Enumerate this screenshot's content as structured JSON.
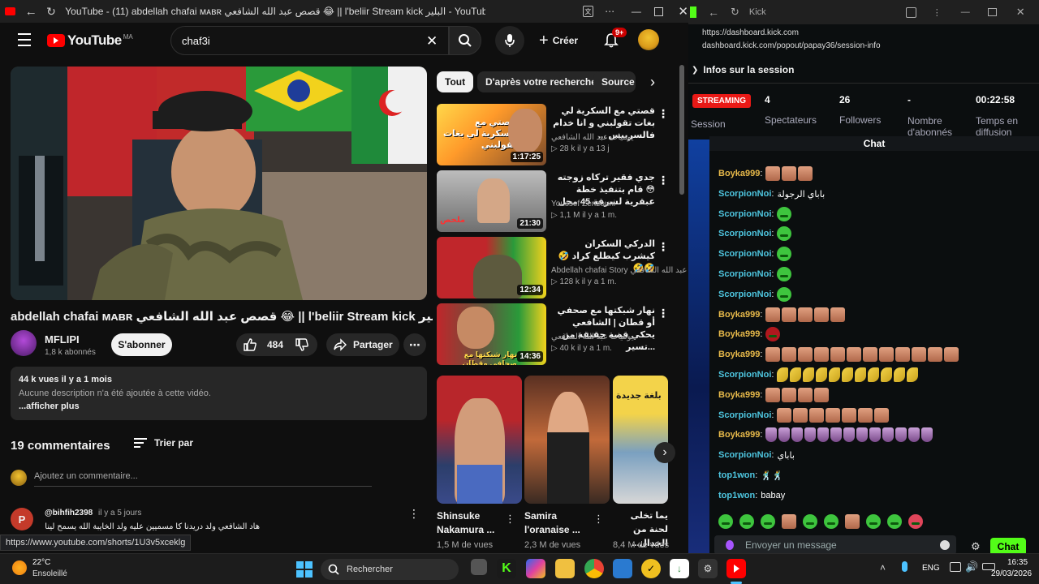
{
  "youtube_window": {
    "title": "YouTube - (11) abdellah chafai ᴍᴀʙʀ قصص عبد الله الشافعي 😂 || l'beliir Stream kick البلير - YouTube",
    "logo_text": "YouTube",
    "logo_region": "MA",
    "search_value": "chaf3i",
    "create_label": "Créer",
    "notif_badge": "9+",
    "video_title": "abdellah chafai ᴍᴀʙʀ قصص عبد الله الشافعي 😂 || l'beliir Stream kick البلير",
    "channel": {
      "name": "MFLIPI",
      "subs": "1,8 k abonnés",
      "subscribe_label": "S'abonner"
    },
    "likes": "484",
    "share_label": "Partager",
    "desc": {
      "stats": "44 k vues  il y a 1 mois",
      "text": "Aucune description n'a été ajoutée à cette vidéo.",
      "more": "...afficher plus"
    },
    "comments_count": "19 commentaires",
    "sort_label": "Trier par",
    "add_comment_placeholder": "Ajoutez un commentaire...",
    "comment": {
      "author": "@bihfih2398",
      "time": "il y a 5 jours",
      "text": "هاد الشافعي ولد دريدنا كا مسميين عليه ولد الخايبة الله يسمح لينا عقل الصغر",
      "avatar_letter": "P"
    },
    "status_url": "https://www.youtube.com/shorts/1U3v5xceklg",
    "chips": [
      "Tout",
      "D'après votre recherche",
      "Source"
    ],
    "recommendations": [
      {
        "title": "قصتي مع السكرية لي بغات تقولبني و انا خدام فالسربيس ...",
        "channel": "يوميات عبد الله الشافعي",
        "views": "▷ 28 k  il y a 13 j",
        "duration": "1:17:25",
        "overlay": "قصتي مع السكرية لي بغات تقولبني"
      },
      {
        "title": "جدي فقير تركاه زوجته 😳 قام بتنفيذ خطة عبقرية لسرقة 45 محل",
        "channel": "Youssef Zenzouni",
        "views": "▷ 1,1 M  il y a 1 m.",
        "duration": "21:30",
        "overlay": "ملخص"
      },
      {
        "title": "الدركي السكران كيشرب كيطلع كراد 🤣🤣🤣",
        "channel": "Abdellah chafai Story عبد الله الشافعي",
        "views": "▷ 128 k  il y a 1 m.",
        "duration": "12:34",
        "overlay": ""
      },
      {
        "title": "نهار شبكتها مع صحفي أو قطان | الشافعي يحكي قصة حقيقة من ...تسير",
        "channel": "يوميات عبد الله الشافعي",
        "views": "▷ 40 k  il y a 1 m.",
        "duration": "14:36",
        "overlay": "نهار شبكتها مع صحافي وقطان"
      }
    ],
    "shorts": [
      {
        "title": "Shinsuke Nakamura ...",
        "views": "1,5 M de vues"
      },
      {
        "title": "Samira l'oranaise ...",
        "views": "2,3 M de vues"
      },
      {
        "title": "يما تخلى لحنة من الخدال...",
        "views": "8,4 M de vues"
      }
    ],
    "short3_overlay": "بلغة جديدة"
  },
  "kick_window": {
    "title": "Kick",
    "url1": "https://dashboard.kick.com",
    "url2": "dashboard.kick.com/popout/papay36/session-info",
    "session_header": "Infos sur la session",
    "streaming_badge": "STREAMING",
    "session_label": "Session",
    "stats": [
      {
        "value": "4",
        "label": "Spectateurs"
      },
      {
        "value": "26",
        "label": "Followers"
      },
      {
        "value": "-",
        "label": "Nombre d'abonnés"
      },
      {
        "value": "00:22:58",
        "label": "Temps en diffusion"
      }
    ],
    "chat_header": "Chat",
    "messages": [
      {
        "user": "Boyka999",
        "color": "#e7b94a",
        "text": "",
        "emotes": "face:3"
      },
      {
        "user": "ScorpionNoi",
        "color": "#4ec6e0",
        "text": "باباي الرجولة",
        "emotes": ""
      },
      {
        "user": "ScorpionNoi",
        "color": "#4ec6e0",
        "text": "",
        "emotes": "green:1"
      },
      {
        "user": "ScorpionNoi",
        "color": "#4ec6e0",
        "text": "",
        "emotes": "green:1"
      },
      {
        "user": "ScorpionNoi",
        "color": "#4ec6e0",
        "text": "",
        "emotes": "green:1"
      },
      {
        "user": "ScorpionNoi",
        "color": "#4ec6e0",
        "text": "",
        "emotes": "green:1"
      },
      {
        "user": "ScorpionNoi",
        "color": "#4ec6e0",
        "text": "",
        "emotes": "green:1"
      },
      {
        "user": "Boyka999",
        "color": "#e7b94a",
        "text": "",
        "emotes": "face:5"
      },
      {
        "user": "Boyka999",
        "color": "#e7b94a",
        "text": "",
        "emotes": "red:1"
      },
      {
        "user": "Boyka999",
        "color": "#e7b94a",
        "text": "",
        "emotes": "face:12"
      },
      {
        "user": "ScorpionNoi",
        "color": "#4ec6e0",
        "text": "",
        "emotes": "banana:11"
      },
      {
        "user": "Boyka999",
        "color": "#e7b94a",
        "text": "",
        "emotes": "face:4"
      },
      {
        "user": "ScorpionNoi",
        "color": "#4ec6e0",
        "text": "",
        "emotes": "face:7"
      },
      {
        "user": "Boyka999",
        "color": "#e7b94a",
        "text": "",
        "emotes": "purple:13"
      },
      {
        "user": "ScorpionNoi",
        "color": "#4ec6e0",
        "text": "باباي",
        "emotes": ""
      },
      {
        "user": "top1won",
        "color": "#4ec6e0",
        "text": "🕺🕺",
        "emotes": ""
      },
      {
        "user": "top1won",
        "color": "#4ec6e0",
        "text": "babay",
        "emotes": ""
      }
    ],
    "chat_placeholder": "Envoyer un message",
    "chat_button": "Chat"
  },
  "taskbar": {
    "weather_temp": "22°C",
    "weather_desc": "Ensoleillé",
    "search_label": "Rechercher",
    "lang": "ENG",
    "time": "16:35",
    "date": "29/03/2026"
  }
}
